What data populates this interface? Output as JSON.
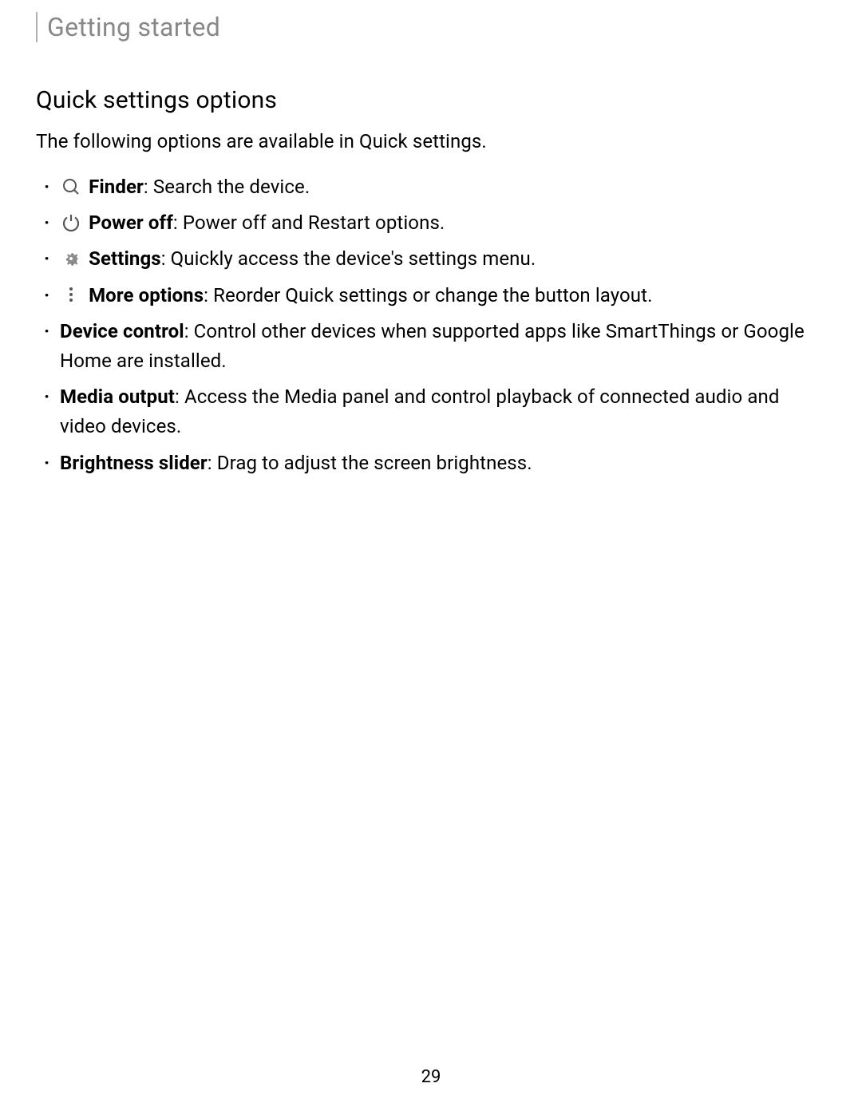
{
  "header": {
    "section": "Getting started"
  },
  "heading": "Quick settings options",
  "intro": "The following options are available in Quick settings.",
  "options": [
    {
      "icon": "search-icon",
      "label": "Finder",
      "desc": ": Search the device."
    },
    {
      "icon": "power-icon",
      "label": "Power off",
      "desc": ": Power off and Restart options."
    },
    {
      "icon": "gear-icon",
      "label": "Settings",
      "desc": ": Quickly access the device's settings menu."
    },
    {
      "icon": "more-icon",
      "label": "More options",
      "desc": ": Reorder Quick settings or change the button layout."
    },
    {
      "icon": null,
      "label": "Device control",
      "desc": ": Control other devices when supported apps like SmartThings or Google Home are installed."
    },
    {
      "icon": null,
      "label": "Media output",
      "desc": ": Access the Media panel and control playback of connected audio and video devices."
    },
    {
      "icon": null,
      "label": "Brightness slider",
      "desc": ": Drag to adjust the screen brightness."
    }
  ],
  "page_number": "29"
}
